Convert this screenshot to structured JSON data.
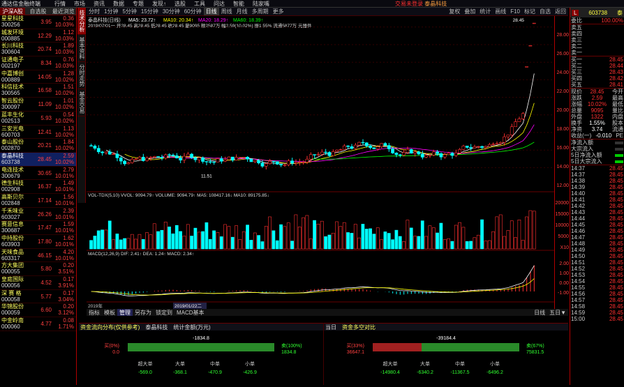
{
  "app": {
    "title": "通达信金融终端",
    "menu": [
      "行情",
      "市场",
      "资讯",
      "数据",
      "专题",
      "发现↑",
      "选股",
      "工具",
      "问达",
      "智能",
      "陆家嘴"
    ],
    "center_text": "交易未登录",
    "stock_name": "泰晶科技",
    "right_menu": [
      "功能",
      "服务"
    ]
  },
  "left": {
    "tabs": [
      "沪深A股",
      "自选股",
      "最近浏览"
    ],
    "rows": [
      {
        "name": "星星科技",
        "code": "300256",
        "price": "3.95",
        "change": "0.36",
        "pct": "10.03%"
      },
      {
        "name": "城发环境",
        "code": "000885",
        "price": "12.29",
        "change": "1.12",
        "pct": "10.03%"
      },
      {
        "name": "长川科技",
        "code": "300604",
        "price": "20.74",
        "change": "1.89",
        "pct": "10.03%"
      },
      {
        "name": "证通电子",
        "code": "002197",
        "price": "8.34",
        "change": "0.76",
        "pct": "10.03%"
      },
      {
        "name": "中嘉博创",
        "code": "000889",
        "price": "14.05",
        "change": "1.28",
        "pct": "10.02%"
      },
      {
        "name": "科信技术",
        "code": "300565",
        "price": "16.58",
        "change": "1.51",
        "pct": "10.02%"
      },
      {
        "name": "智云股份",
        "code": "300097",
        "price": "11.09",
        "change": "1.01",
        "pct": "10.02%"
      },
      {
        "name": "蓝丰生化",
        "code": "002513",
        "price": "5.93",
        "change": "0.54",
        "pct": "10.02%"
      },
      {
        "name": "三安光电",
        "code": "600703",
        "price": "12.41",
        "change": "1.13",
        "pct": "10.02%"
      },
      {
        "name": "泰山股份",
        "code": "002870",
        "price": "20.21",
        "change": "1.84",
        "pct": "10.02%"
      },
      {
        "name": "泰晶科技",
        "code": "603738",
        "price": "28.45",
        "change": "2.59",
        "pct": "10.02%"
      },
      {
        "name": "电连技术",
        "code": "300679",
        "price": "30.65",
        "change": "2.79",
        "pct": "10.01%"
      },
      {
        "name": "德生科技",
        "code": "002908",
        "price": "16.37",
        "change": "1.49",
        "pct": "10.01%"
      },
      {
        "name": "高斯贝尔",
        "code": "002848",
        "price": "17.14",
        "change": "1.56",
        "pct": "10.01%"
      },
      {
        "name": "千禾味业",
        "code": "603027",
        "price": "26.26",
        "change": "2.39",
        "pct": "10.01%"
      },
      {
        "name": "赛意信息",
        "code": "300687",
        "price": "17.47",
        "change": "1.59",
        "pct": "10.01%"
      },
      {
        "name": "中持股份",
        "code": "603903",
        "price": "17.80",
        "change": "1.62",
        "pct": "10.01%"
      },
      {
        "name": "天味食品",
        "code": "603317",
        "price": "46.15",
        "change": "4.20",
        "pct": "10.01%"
      },
      {
        "name": "方大集团",
        "code": "000055",
        "price": "5.80",
        "change": "0.20",
        "pct": "3.51%"
      },
      {
        "name": "皇庭国际",
        "code": "000056",
        "price": "4.52",
        "change": "0.17",
        "pct": "3.91%"
      },
      {
        "name": "深 赛 格",
        "code": "000058",
        "price": "5.77",
        "change": "0.17",
        "pct": "3.04%"
      },
      {
        "name": "华锦股份",
        "code": "000059",
        "price": "6.60",
        "change": "0.20",
        "pct": "3.12%"
      },
      {
        "name": "中金岭南",
        "code": "000060",
        "price": "4.77",
        "change": "0.08",
        "pct": "1.71%"
      }
    ]
  },
  "vtabs": [
    "技术分析",
    "基本资料",
    "分时走势",
    "基金交易"
  ],
  "periods": [
    "分时",
    "1分钟",
    "5分钟",
    "15分钟",
    "30分钟",
    "60分钟",
    "日线",
    "周线",
    "月线",
    "多周期",
    "更多"
  ],
  "ptop_right": [
    "复权",
    "叠加",
    "统计",
    "画线",
    "F10",
    "标记",
    "自选",
    "返回"
  ],
  "chart": {
    "title": "泰晶科技(日线)",
    "ma": [
      "MA5: 23.72↑",
      "MA10: 20.34↑",
      "MA20: 18.29↑",
      "MA60: 18.39↑"
    ],
    "info": "2019/07/01一 开28.45 高28.45 低28.45 收28.45 量9095 额2587万 幅2.59(10.02%) 振1.55% 流通5877万 元器件",
    "high_label": "28.45",
    "low_label": "11.51",
    "vol_label": "VOL-TDX(5,10) VVOL: 9094.79↑ VOLUME: 9094.79↑ MA5: 108417.16↓ MA10: 89175.85↓",
    "macd_label": "MACD(12,26,9) DIF: 2.41↑ DEA: 1.24↑ MACD: 2.34↑",
    "date_left": "2019年",
    "date_cur": "2019/01/22二"
  },
  "y_axis": [
    "28.00",
    "26.00",
    "24.00",
    "22.00",
    "20.00",
    "18.00",
    "16.00",
    "14.00",
    "12.00"
  ],
  "vol_axis": [
    "20000",
    "15000",
    "10000",
    "5000",
    "X10"
  ],
  "macd_axis": [
    "2.00",
    "1.00",
    "0.00",
    "-1.00"
  ],
  "bottom_tabs": [
    "指标",
    "模板",
    "管理",
    "另存为",
    "锁定到",
    "MACD基本"
  ],
  "bottom_right": [
    "日线",
    "五日▼"
  ],
  "dist": {
    "title": "资金流向分布(仅供参考)",
    "tabs": [
      "泰晶科技",
      "统计金额(万元)"
    ],
    "day": "当日",
    "total": "-1834.8",
    "buy_lbl": "买(0%)",
    "buy_val": "0.0",
    "sell_lbl": "卖(100%)",
    "sell_val": "1834.8",
    "cats": [
      "超大单",
      "大单",
      "中单",
      "小单"
    ],
    "cat_vals": [
      "-569.0",
      "-368.1",
      "-470.9",
      "-426.9"
    ]
  },
  "dist2": {
    "title": "资金多空对比",
    "total": "-39184.4",
    "buy_lbl": "买(33%)",
    "buy_val": "36647.1",
    "sell_lbl": "卖(67%)",
    "sell_val": "75831.5",
    "cats": [
      "超大单",
      "大单",
      "中单",
      "小单"
    ],
    "cat_vals": [
      "-14980.4",
      "-6340.2",
      "-11367.5",
      "-6496.2"
    ]
  },
  "right": {
    "badge": "L",
    "code": "603738",
    "name": "泰",
    "webi_lbl": "委比",
    "webi": "100.00%",
    "sells": [
      "卖五",
      "卖四",
      "卖三",
      "卖二",
      "卖一"
    ],
    "buys": [
      {
        "l": "买一",
        "p": "28.45"
      },
      {
        "l": "买二",
        "p": "28.44"
      },
      {
        "l": "买三",
        "p": "28.43"
      },
      {
        "l": "买四",
        "p": "28.42"
      },
      {
        "l": "买五",
        "p": "28.41"
      }
    ],
    "stats": [
      {
        "l": "现价",
        "v": "28.45",
        "x": "今开"
      },
      {
        "l": "涨跌",
        "v": "2.59",
        "x": "最高"
      },
      {
        "l": "涨幅",
        "v": "10.02%",
        "x": "最低"
      },
      {
        "l": "总量",
        "v": "9095",
        "x": "量比"
      },
      {
        "l": "外盘",
        "v": "1322",
        "x": "内盘"
      },
      {
        "l": "换手",
        "v": "1.55%",
        "x": "股本"
      },
      {
        "l": "净资",
        "v": "3.74",
        "x": "流通"
      },
      {
        "l": "收益(一)",
        "v": "-0.010",
        "x": "PE"
      }
    ],
    "flows": [
      "净流入额",
      "大宗流入",
      "5日净流入额",
      "5日大宗流入"
    ],
    "ticks": [
      {
        "t": "14:37",
        "p": "28.45"
      },
      {
        "t": "14:37",
        "p": "28.45"
      },
      {
        "t": "14:38",
        "p": "28.45"
      },
      {
        "t": "14:39",
        "p": "28.45"
      },
      {
        "t": "14:40",
        "p": "28.45"
      },
      {
        "t": "14:41",
        "p": "28.45"
      },
      {
        "t": "14:42",
        "p": "28.45"
      },
      {
        "t": "14:43",
        "p": "28.45"
      },
      {
        "t": "14:44",
        "p": "28.45"
      },
      {
        "t": "14:45",
        "p": "28.45"
      },
      {
        "t": "14:46",
        "p": "28.45"
      },
      {
        "t": "14:47",
        "p": "28.45"
      },
      {
        "t": "14:48",
        "p": "28.45"
      },
      {
        "t": "14:49",
        "p": "28.45"
      },
      {
        "t": "14:50",
        "p": "28.45"
      },
      {
        "t": "14:51",
        "p": "28.45"
      },
      {
        "t": "14:52",
        "p": "28.45"
      },
      {
        "t": "14:53",
        "p": "28.45"
      },
      {
        "t": "14:54",
        "p": "28.45"
      },
      {
        "t": "14:55",
        "p": "28.45"
      },
      {
        "t": "14:56",
        "p": "28.45"
      },
      {
        "t": "14:57",
        "p": "28.45"
      },
      {
        "t": "14:58",
        "p": "28.45"
      },
      {
        "t": "14:59",
        "p": "28.45"
      },
      {
        "t": "15:00",
        "p": "28.45"
      }
    ]
  },
  "colors": {
    "up": "#ff3030",
    "down": "#00ffff",
    "accent": "#b00000",
    "ma5": "#ffffff",
    "ma10": "#ffff00",
    "ma20": "#ff00ff",
    "ma60": "#00ff00"
  }
}
